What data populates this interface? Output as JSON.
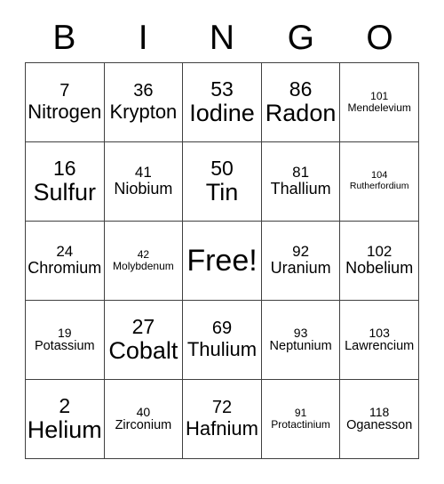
{
  "card": {
    "type": "element-bingo-card",
    "header": {
      "letters": [
        "B",
        "I",
        "N",
        "G",
        "O"
      ]
    },
    "grid": {
      "rows": 5,
      "columns": 5,
      "border_color": "#404040",
      "background_color": "#ffffff",
      "text_color": "#000000"
    },
    "free_space": {
      "label": "Free!",
      "row": 2,
      "column": 2
    },
    "cells": [
      [
        {
          "number": "7",
          "name": "Nitrogen",
          "size": "sz-lg"
        },
        {
          "number": "36",
          "name": "Krypton",
          "size": "sz-lg"
        },
        {
          "number": "53",
          "name": "Iodine",
          "size": "sz-xl"
        },
        {
          "number": "86",
          "name": "Radon",
          "size": "sz-xl"
        },
        {
          "number": "101",
          "name": "Mendelevium",
          "size": "sz-xs"
        }
      ],
      [
        {
          "number": "16",
          "name": "Sulfur",
          "size": "sz-xl"
        },
        {
          "number": "41",
          "name": "Niobium",
          "size": "sz-md"
        },
        {
          "number": "50",
          "name": "Tin",
          "size": "sz-xl"
        },
        {
          "number": "81",
          "name": "Thallium",
          "size": "sz-md"
        },
        {
          "number": "104",
          "name": "Rutherfordium",
          "size": "sz-xxs"
        }
      ],
      [
        {
          "number": "24",
          "name": "Chromium",
          "size": "sz-md"
        },
        {
          "number": "42",
          "name": "Molybdenum",
          "size": "sz-xs"
        },
        {
          "number": "",
          "name": "Free!",
          "size": "free"
        },
        {
          "number": "92",
          "name": "Uranium",
          "size": "sz-md"
        },
        {
          "number": "102",
          "name": "Nobelium",
          "size": "sz-md"
        }
      ],
      [
        {
          "number": "19",
          "name": "Potassium",
          "size": "sz-sm"
        },
        {
          "number": "27",
          "name": "Cobalt",
          "size": "sz-xl"
        },
        {
          "number": "69",
          "name": "Thulium",
          "size": "sz-lg"
        },
        {
          "number": "93",
          "name": "Neptunium",
          "size": "sz-sm"
        },
        {
          "number": "103",
          "name": "Lawrencium",
          "size": "sz-sm"
        }
      ],
      [
        {
          "number": "2",
          "name": "Helium",
          "size": "sz-xl"
        },
        {
          "number": "40",
          "name": "Zirconium",
          "size": "sz-sm"
        },
        {
          "number": "72",
          "name": "Hafnium",
          "size": "sz-lg"
        },
        {
          "number": "91",
          "name": "Protactinium",
          "size": "sz-xs"
        },
        {
          "number": "118",
          "name": "Oganesson",
          "size": "sz-sm"
        }
      ]
    ]
  }
}
